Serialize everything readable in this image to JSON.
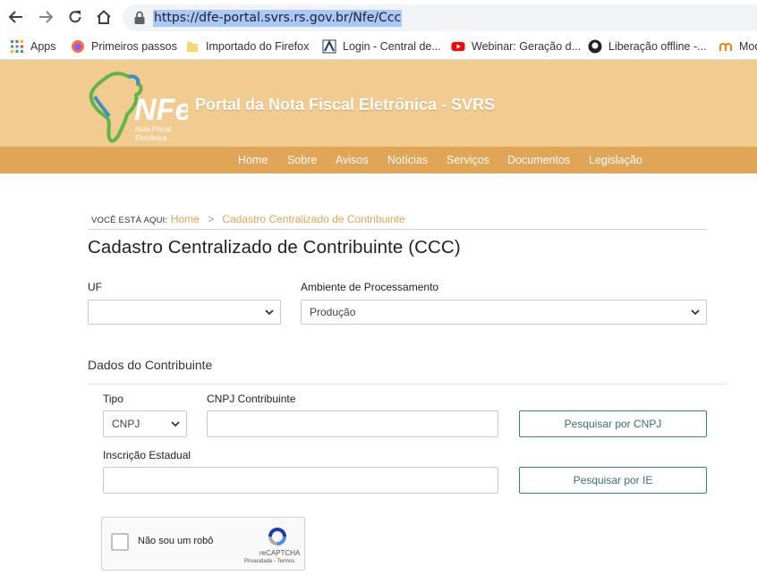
{
  "browser": {
    "url": "https://dfe-portal.svrs.rs.gov.br/Nfe/Ccc",
    "bookmarks": [
      {
        "label": "Apps",
        "icon": "apps-grid-icon"
      },
      {
        "label": "Primeiros passos",
        "icon": "firefox-icon"
      },
      {
        "label": "Importado do Firefox",
        "icon": "folder-icon"
      },
      {
        "label": "Login - Central de...",
        "icon": "site-logo-icon"
      },
      {
        "label": "Webinar: Geração d...",
        "icon": "youtube-icon"
      },
      {
        "label": "Liberação offline -...",
        "icon": "github-icon"
      },
      {
        "label": "Mod",
        "icon": "moodle-icon"
      }
    ]
  },
  "header": {
    "logo_text": "NFe",
    "logo_sub_1": "Nota Fiscal",
    "logo_sub_2": "Eletrônica",
    "portal_title": "Portal da Nota Fiscal Eletrônica - SVRS"
  },
  "menu": [
    "Home",
    "Sobre",
    "Avisos",
    "Notícias",
    "Serviços",
    "Documentos",
    "Legislação"
  ],
  "breadcrumb": {
    "label": "VOCÊ ESTÁ AQUI:",
    "home": "Home",
    "separator": ">",
    "current": "Cadastro Centralizado de Contribuinte"
  },
  "page_title": "Cadastro Centralizado de Contribuinte (CCC)",
  "form": {
    "uf_label": "UF",
    "uf_value": "",
    "ambiente_label": "Ambiente de Processamento",
    "ambiente_value": "Produção",
    "section_title": "Dados do Contribuinte",
    "tipo_label": "Tipo",
    "tipo_value": "CNPJ",
    "cnpj_label": "CNPJ Contribuinte",
    "cnpj_value": "",
    "ie_label": "Inscrição Estadual",
    "ie_value": "",
    "search_cnpj_button": "Pesquisar por CNPJ",
    "search_ie_button": "Pesquisar por IE"
  },
  "captcha": {
    "text": "Não sou um robô",
    "brand": "reCAPTCHA",
    "terms": "Privacidade - Termos"
  },
  "colors": {
    "banner": "#f2cb91",
    "menu": "#e1a558",
    "accent_link": "#e1a558",
    "button_border": "#3f7f7d"
  }
}
